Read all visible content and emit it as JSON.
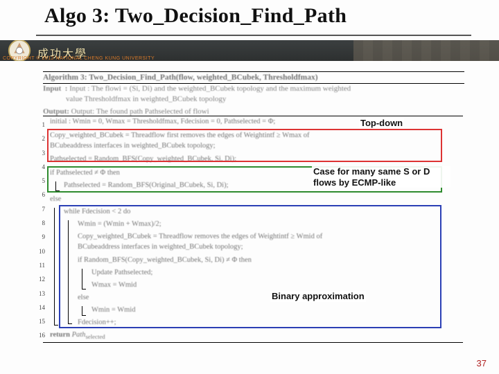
{
  "title": "Algo 3: Two_Decision_Find_Path",
  "university_cn": "成功大學",
  "copyright": "COPYRIGHT © 2012 NATIONAL CHENG KUNG UNIVERSITY",
  "page_number": "37",
  "algorithm_header": "Algorithm 3: Two_Decision_Find_Path(flow, weighted_BCubek, Thresholdfmax)",
  "input_line1": "Input  : The flowi = (Si, Di) and the weighted_BCubek topology and the maximum weighted",
  "input_line2": "value Thresholdfmax in weighted_BCubek topology",
  "output_line": "Output: The found path Pathselected of flowi",
  "line_numbers": [
    "1",
    "2",
    "3",
    "4",
    "5",
    "6",
    "7",
    "8",
    "9",
    "10",
    "11",
    "12",
    "13",
    "14",
    "15",
    "16"
  ],
  "annot_top_down": "Top-down",
  "annot_case": "Case for many same S or D flows by ECMP-like",
  "annot_binary": "Binary approximation",
  "pseudo": {
    "l1": "initial : Wmin = 0, Wmax = Thresholdfmax, Fdecision = 0, Pathselected = Φ;",
    "l2": "Copy_weighted_BCubek = Threadflow first removes the edges of Weightintf ≥ Wmax of",
    "l2b": "BCubeaddress interfaces in weighted_BCubek topology;",
    "l3": "Pathselected = Random_BFS(Copy_weighted_BCubek, Si, Di);",
    "l4": "if  Pathselected ≠ Φ then",
    "l5": "Pathselected = Random_BFS(Original_BCubek, Si, Di);",
    "l6": "else",
    "l7": "while Fdecision < 2 do",
    "l8": "Wmin = (Wmin + Wmax)/2;",
    "l9": "Copy_weighted_BCubek = Threadflow removes the edges of Weightintf ≥ Wmid of",
    "l9b": "BCubeaddress interfaces in weighted_BCubek topology;",
    "l10": "if Random_BFS(Copy_weighted_BCubek, Si, Di) ≠ Φ  then",
    "l11": "Update Pathselected;",
    "l12": "Wmax = Wmid",
    "l13": "else",
    "l14": "Wmin = Wmid",
    "l15": "Fdecision++;",
    "l16": "return Pathselected"
  }
}
